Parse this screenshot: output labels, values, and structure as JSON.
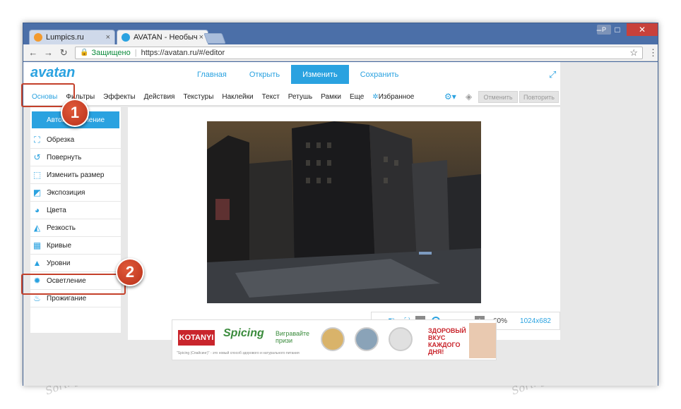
{
  "browser": {
    "tabs": [
      {
        "title": "Lumpics.ru",
        "close": "×"
      },
      {
        "title": "AVATAN - Необычный ф",
        "close": "×"
      }
    ],
    "window_controls": {
      "min": "–",
      "max": "□",
      "close": "✕"
    },
    "profile": "P",
    "nav": {
      "back": "←",
      "forward": "→",
      "reload": "↻"
    },
    "address": {
      "secure_label": "Защищено",
      "separator": "|",
      "url": "https://avatan.ru/#/editor",
      "star": "☆",
      "menu": "⋮"
    }
  },
  "app": {
    "logo": "avatan",
    "topnav": [
      "Главная",
      "Открыть",
      "Изменить",
      "Сохранить"
    ],
    "expand": "⤢",
    "toolbar": [
      "Основы",
      "Фильтры",
      "Эффекты",
      "Действия",
      "Текстуры",
      "Наклейки",
      "Текст",
      "Ретушь",
      "Рамки",
      "Еще"
    ],
    "favorites": "Избранное",
    "undo": "Отменить",
    "redo": "Повторить",
    "sidebar": {
      "auto": "Автоисправление",
      "items": [
        "Обрезка",
        "Повернуть",
        "Изменить размер",
        "Экспозиция",
        "Цвета",
        "Резкость",
        "Кривые",
        "Уровни",
        "Осветление",
        "Прожигание"
      ]
    },
    "zoom": {
      "minus": "−",
      "plus": "+",
      "value": "60%",
      "size": "1024x682",
      "fraction": 0.1
    }
  },
  "ad": {
    "brand": "KOTANYI",
    "spicing": "Spicing",
    "prize": "Вигравайте призи",
    "tagline": "ЗДОРОВЫЙ ВКУС КАЖДОГО ДНЯ!",
    "fine": "\"Spicing (Спайсинг)\" - это новый способ здорового и натурального питания"
  },
  "annotations": {
    "callout1": "1",
    "callout2": "2"
  },
  "watermark": "Soringpcrepair.Com",
  "colors": {
    "accent": "#2aa2e0",
    "callout": "#c4402a"
  }
}
